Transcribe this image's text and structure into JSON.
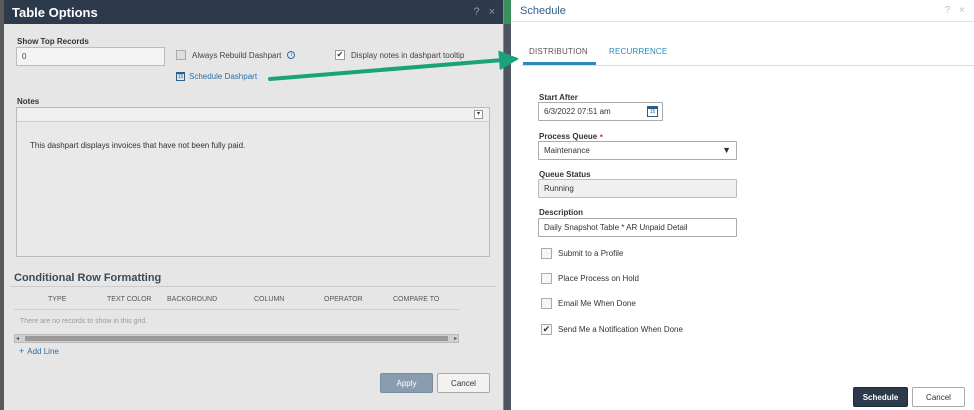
{
  "table_options": {
    "title": "Table Options",
    "help_icon": "?",
    "close_icon": "×",
    "show_top_records_label": "Show Top Records",
    "show_top_records_value": "0",
    "always_rebuild_label": "Always Rebuild Dashpart",
    "always_rebuild_checked": false,
    "display_notes_label": "Display notes in dashpart tooltip",
    "display_notes_checked": true,
    "schedule_link": "Schedule Dashpart",
    "notes_label": "Notes",
    "notes_text": "This dashpart displays invoices that have not been fully paid.",
    "crf_title": "Conditional Row Formatting",
    "crf_columns": [
      "TYPE",
      "TEXT COLOR",
      "BACKGROUND",
      "COLUMN",
      "OPERATOR",
      "COMPARE TO"
    ],
    "crf_empty": "There are no records to show in this grid.",
    "add_line": "Add Line",
    "apply": "Apply",
    "cancel": "Cancel"
  },
  "schedule": {
    "title": "Schedule",
    "help_icon": "?",
    "close_icon": "×",
    "tabs": [
      {
        "label": "DISTRIBUTION",
        "active": true
      },
      {
        "label": "RECURRENCE",
        "active": false
      }
    ],
    "start_after_label": "Start After",
    "start_after_value": "6/3/2022 07:51 am",
    "process_queue_label": "Process Queue",
    "process_queue_required": "•",
    "process_queue_value": "Maintenance",
    "queue_status_label": "Queue Status",
    "queue_status_value": "Running",
    "description_label": "Description",
    "description_value": "Daily Snapshot Table * AR Unpaid Detail",
    "options": [
      {
        "label": "Submit to a Profile",
        "checked": false
      },
      {
        "label": "Place Process on Hold",
        "checked": false
      },
      {
        "label": "Email Me When Done",
        "checked": false
      },
      {
        "label": "Send Me a Notification When Done",
        "checked": true
      }
    ],
    "schedule_button": "Schedule",
    "cancel_button": "Cancel"
  },
  "colors": {
    "header_dark": "#2c3a4b",
    "link_blue": "#2a6fa8",
    "tab_blue": "#2a8ac0",
    "arrow_green": "#1aa37a",
    "required_red": "#dd3333"
  }
}
